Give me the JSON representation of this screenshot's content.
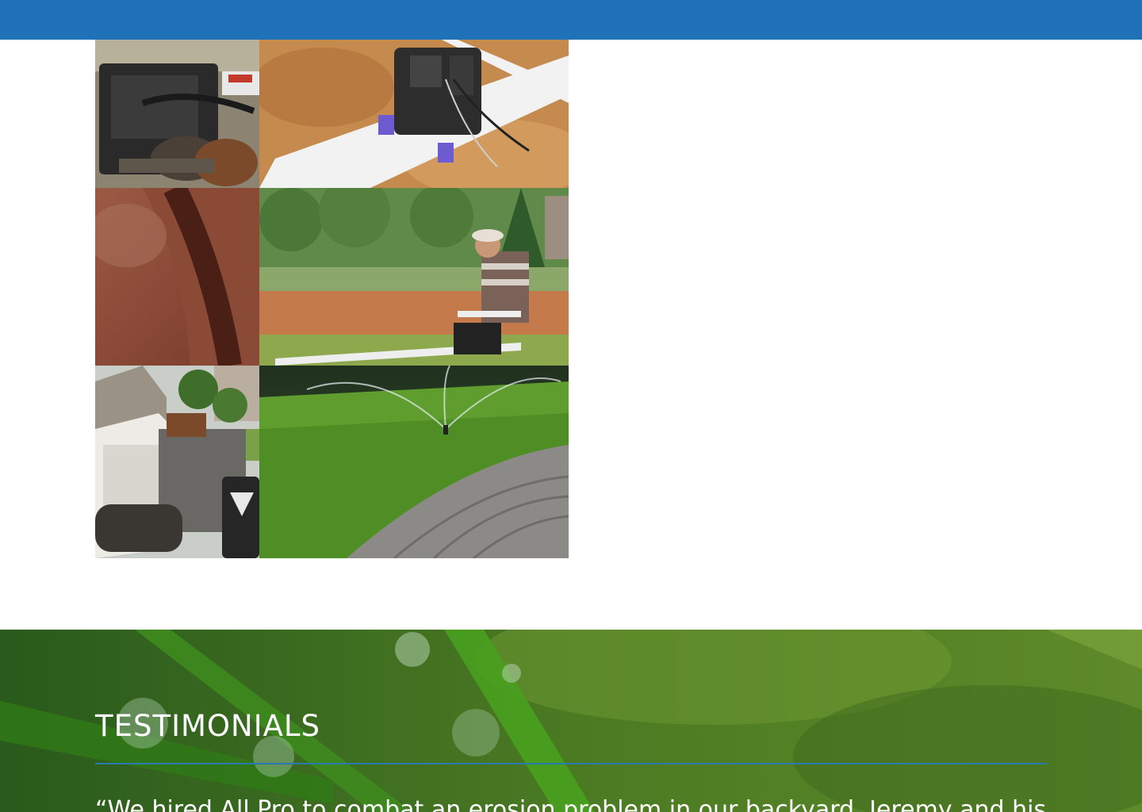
{
  "header": {
    "bar_color": "#1f72b8"
  },
  "gallery": {
    "images": [
      {
        "name": "auger-machine-photo"
      },
      {
        "name": "irrigation-valve-pipes-photo"
      },
      {
        "name": "dirt-trench-closeup-photo"
      },
      {
        "name": "worker-laying-pipe-photo"
      },
      {
        "name": "bobcat-trencher-photo"
      },
      {
        "name": "sprinkler-on-lawn-photo"
      }
    ]
  },
  "testimonials": {
    "heading": "TESTIMONIALS",
    "quote": "“We hired All Pro to combat an erosion problem in our backyard. Jeremy and his",
    "rule_color": "#2a7ab0"
  }
}
